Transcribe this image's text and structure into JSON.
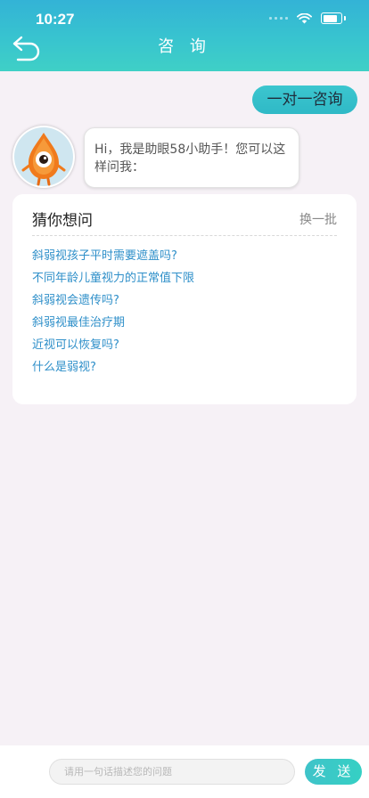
{
  "status_bar": {
    "time": "10:27"
  },
  "header": {
    "title": "咨 询",
    "back_icon": "back-arrow-icon"
  },
  "consult_button": {
    "label": "一对一咨询"
  },
  "assistant": {
    "avatar_icon": "mascot-eye-avatar-icon",
    "greeting": "Hi，我是助眼58小助手！您可以这样问我："
  },
  "suggestions": {
    "title": "猜你想问",
    "refresh_label": "换一批",
    "items": [
      "斜弱视孩子平时需要遮盖吗?",
      "不同年龄儿童视力的正常值下限",
      "斜弱视会遗传吗?",
      "斜弱视最佳治疗期",
      "近视可以恢复吗?",
      "什么是弱视?"
    ]
  },
  "composer": {
    "placeholder": "请用一句话描述您的问题",
    "send_label": "发 送"
  },
  "colors": {
    "header_gradient": [
      "#33b3d6",
      "#3fd0c6"
    ],
    "accent": "#35c2cb",
    "link": "#2e8fc9",
    "background": "#f6f1f6"
  }
}
